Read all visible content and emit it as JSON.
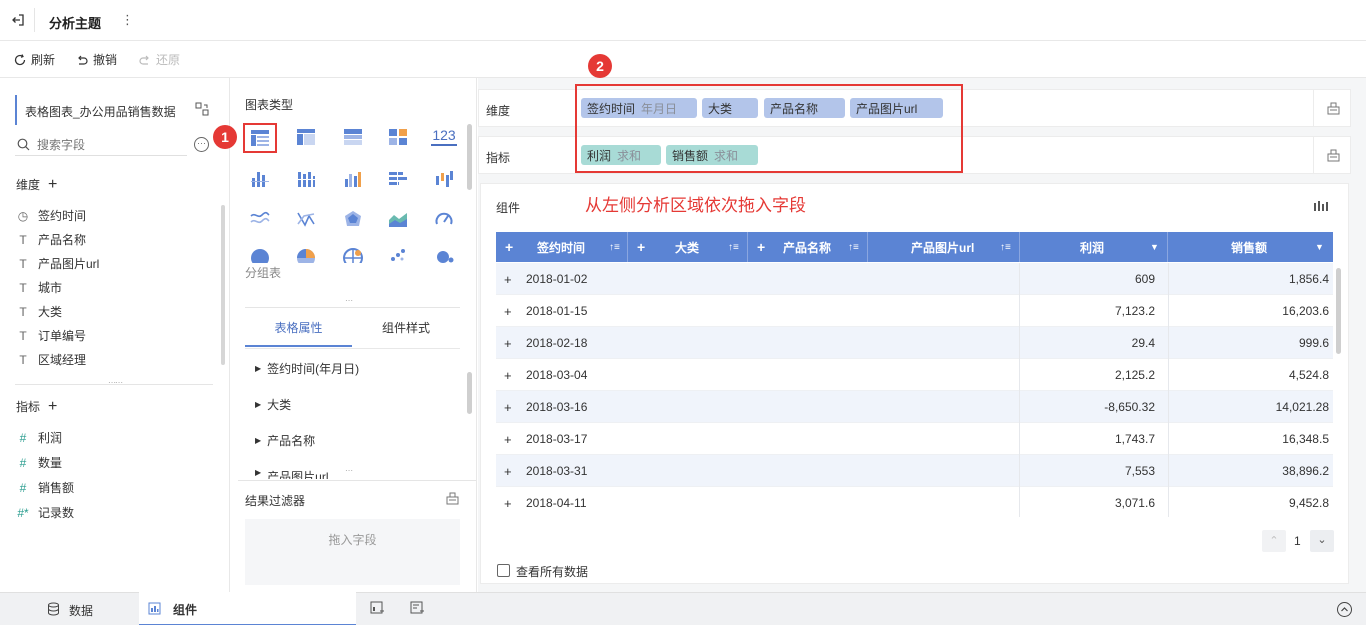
{
  "topbar": {
    "title": "分析主题",
    "more": "⋮"
  },
  "toolbar": {
    "refresh": "刷新",
    "undo": "撤销",
    "redo": "还原"
  },
  "left": {
    "dataset": "表格图表_办公用品销售数据",
    "search_placeholder": "搜索字段",
    "dimensions_label": "维度",
    "dimensions": [
      {
        "icon": "◷",
        "label": "签约时间"
      },
      {
        "icon": "T",
        "label": "产品名称"
      },
      {
        "icon": "T",
        "label": "产品图片url"
      },
      {
        "icon": "T",
        "label": "城市"
      },
      {
        "icon": "T",
        "label": "大类"
      },
      {
        "icon": "T",
        "label": "订单编号"
      },
      {
        "icon": "T",
        "label": "区域经理"
      }
    ],
    "metrics_label": "指标",
    "metrics": [
      {
        "icon": "#",
        "label": "利润"
      },
      {
        "icon": "#",
        "label": "数量"
      },
      {
        "icon": "#",
        "label": "销售额"
      },
      {
        "icon": "#*",
        "label": "记录数"
      }
    ]
  },
  "middle": {
    "chart_type_label": "图表类型",
    "group_table_label": "分组表",
    "tabs": [
      "表格属性",
      "组件样式"
    ],
    "props": [
      "签约时间(年月日)",
      "大类",
      "产品名称",
      "产品图片url"
    ],
    "filter_label": "结果过滤器",
    "drop_hint": "拖入字段"
  },
  "right": {
    "dim_label": "维度",
    "metric_label": "指标",
    "dim_pills": [
      {
        "name": "签约时间",
        "sub": "年月日"
      },
      {
        "name": "大类",
        "sub": ""
      },
      {
        "name": "产品名称",
        "sub": ""
      },
      {
        "name": "产品图片url",
        "sub": ""
      }
    ],
    "metric_pills": [
      {
        "name": "利润",
        "sub": "求和"
      },
      {
        "name": "销售额",
        "sub": "求和"
      }
    ],
    "annotation": "从左侧分析区域依次拖入字段",
    "badge1": "1",
    "badge2": "2",
    "component_label": "组件",
    "headers": [
      "签约时间",
      "大类",
      "产品名称",
      "产品图片url",
      "利润",
      "销售额"
    ],
    "rows": [
      [
        "2018-01-02",
        "609",
        "1,856.4"
      ],
      [
        "2018-01-15",
        "7,123.2",
        "16,203.6"
      ],
      [
        "2018-02-18",
        "29.4",
        "999.6"
      ],
      [
        "2018-03-04",
        "2,125.2",
        "4,524.8"
      ],
      [
        "2018-03-16",
        "-8,650.32",
        "14,021.28"
      ],
      [
        "2018-03-17",
        "1,743.7",
        "16,348.5"
      ],
      [
        "2018-03-31",
        "7,553",
        "38,896.2"
      ],
      [
        "2018-04-11",
        "3,071.6",
        "9,452.8"
      ]
    ],
    "page": "1",
    "view_all": "查看所有数据"
  },
  "bottom": {
    "data_tab": "数据",
    "component_tab": "组件"
  },
  "colors": {
    "accent": "#5b84d4",
    "annotation": "#e53935",
    "dim_pill": "#b3c5ea",
    "metric_pill": "#a8dbd6"
  }
}
